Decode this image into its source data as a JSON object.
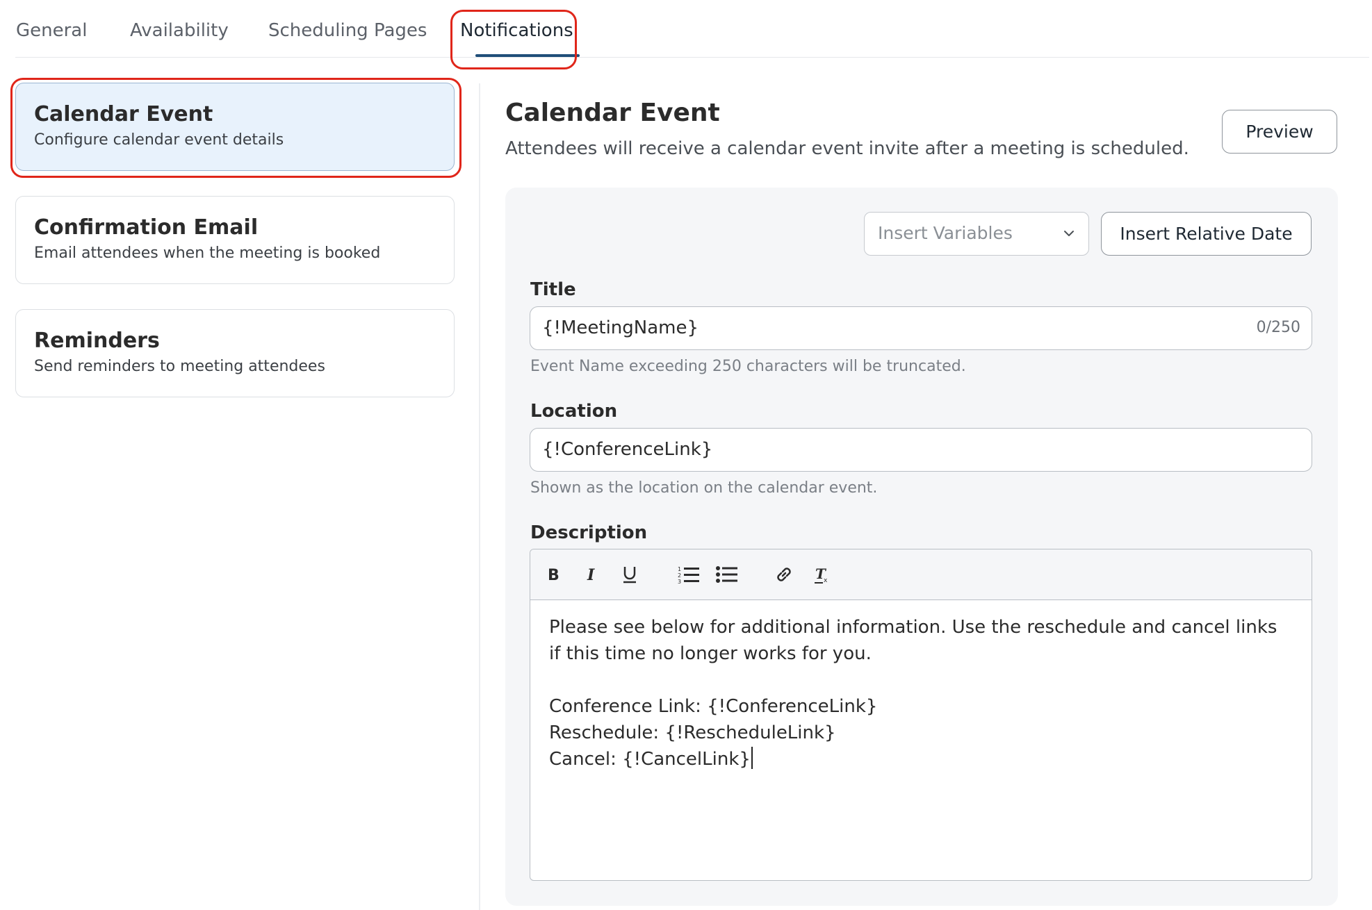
{
  "tabs": {
    "general": "General",
    "availability": "Availability",
    "scheduling_pages": "Scheduling Pages",
    "notifications": "Notifications",
    "active": "Notifications"
  },
  "sidebar": {
    "items": [
      {
        "title": "Calendar Event",
        "description": "Configure calendar event details",
        "selected": true
      },
      {
        "title": "Confirmation Email",
        "description": "Email attendees when the meeting is booked",
        "selected": false
      },
      {
        "title": "Reminders",
        "description": "Send reminders to meeting attendees",
        "selected": false
      }
    ]
  },
  "main": {
    "title": "Calendar Event",
    "subtitle": "Attendees will receive a calendar event invite after a meeting is scheduled.",
    "preview_label": "Preview",
    "insert_variables_placeholder": "Insert Variables",
    "insert_relative_date_label": "Insert Relative Date",
    "title_field": {
      "label": "Title",
      "value": "{!MeetingName}",
      "counter": "0/250",
      "help": "Event Name exceeding 250 characters will be truncated."
    },
    "location_field": {
      "label": "Location",
      "value": "{!ConferenceLink}",
      "help": "Shown as the location on the calendar event."
    },
    "description_field": {
      "label": "Description",
      "toolbar_icons": [
        "bold-icon",
        "italic-icon",
        "underline-icon",
        "numbered-list-icon",
        "bulleted-list-icon",
        "link-icon",
        "clear-format-icon"
      ],
      "lines": [
        "Please see below for additional information. Use the reschedule and cancel links if this time no longer works for you.",
        "",
        "Conference Link: {!ConferenceLink}",
        "Reschedule: {!RescheduleLink}",
        "Cancel: {!CancelLink}"
      ]
    }
  },
  "colors": {
    "highlight": "#e0261a",
    "tab_underline": "#1f4e79",
    "selected_card_bg": "#e8f2fc",
    "panel_bg": "#f5f6f8"
  }
}
